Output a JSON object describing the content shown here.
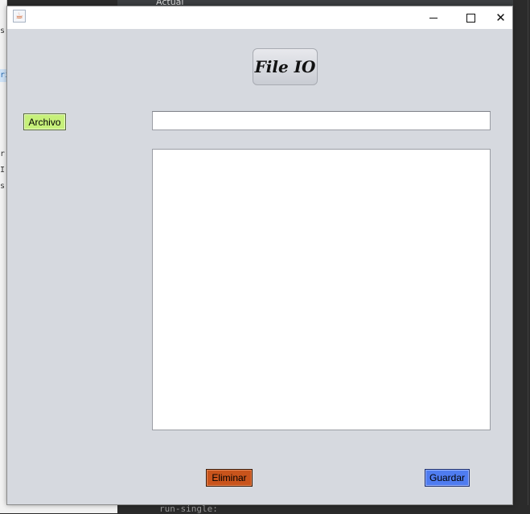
{
  "window": {
    "icon": "java-icon",
    "controls": {
      "minimize": "minimize-icon",
      "maximize": "maximize-icon",
      "close": "close-icon"
    }
  },
  "main": {
    "title": "File IO",
    "archivo_button": "Archivo",
    "path_field_value": "",
    "content_area_value": "",
    "eliminar_button": "Eliminar",
    "guardar_button": "Guardar"
  },
  "background": {
    "left_fragments": [
      "s",
      "ri",
      "r",
      "I",
      "s"
    ],
    "top_title": "Actual",
    "bottom_code": "run-single:"
  },
  "colors": {
    "window_bg": "#d6d9df",
    "archivo": "#c6f07a",
    "eliminar": "#c9541c",
    "guardar": "#4f7cf0"
  }
}
